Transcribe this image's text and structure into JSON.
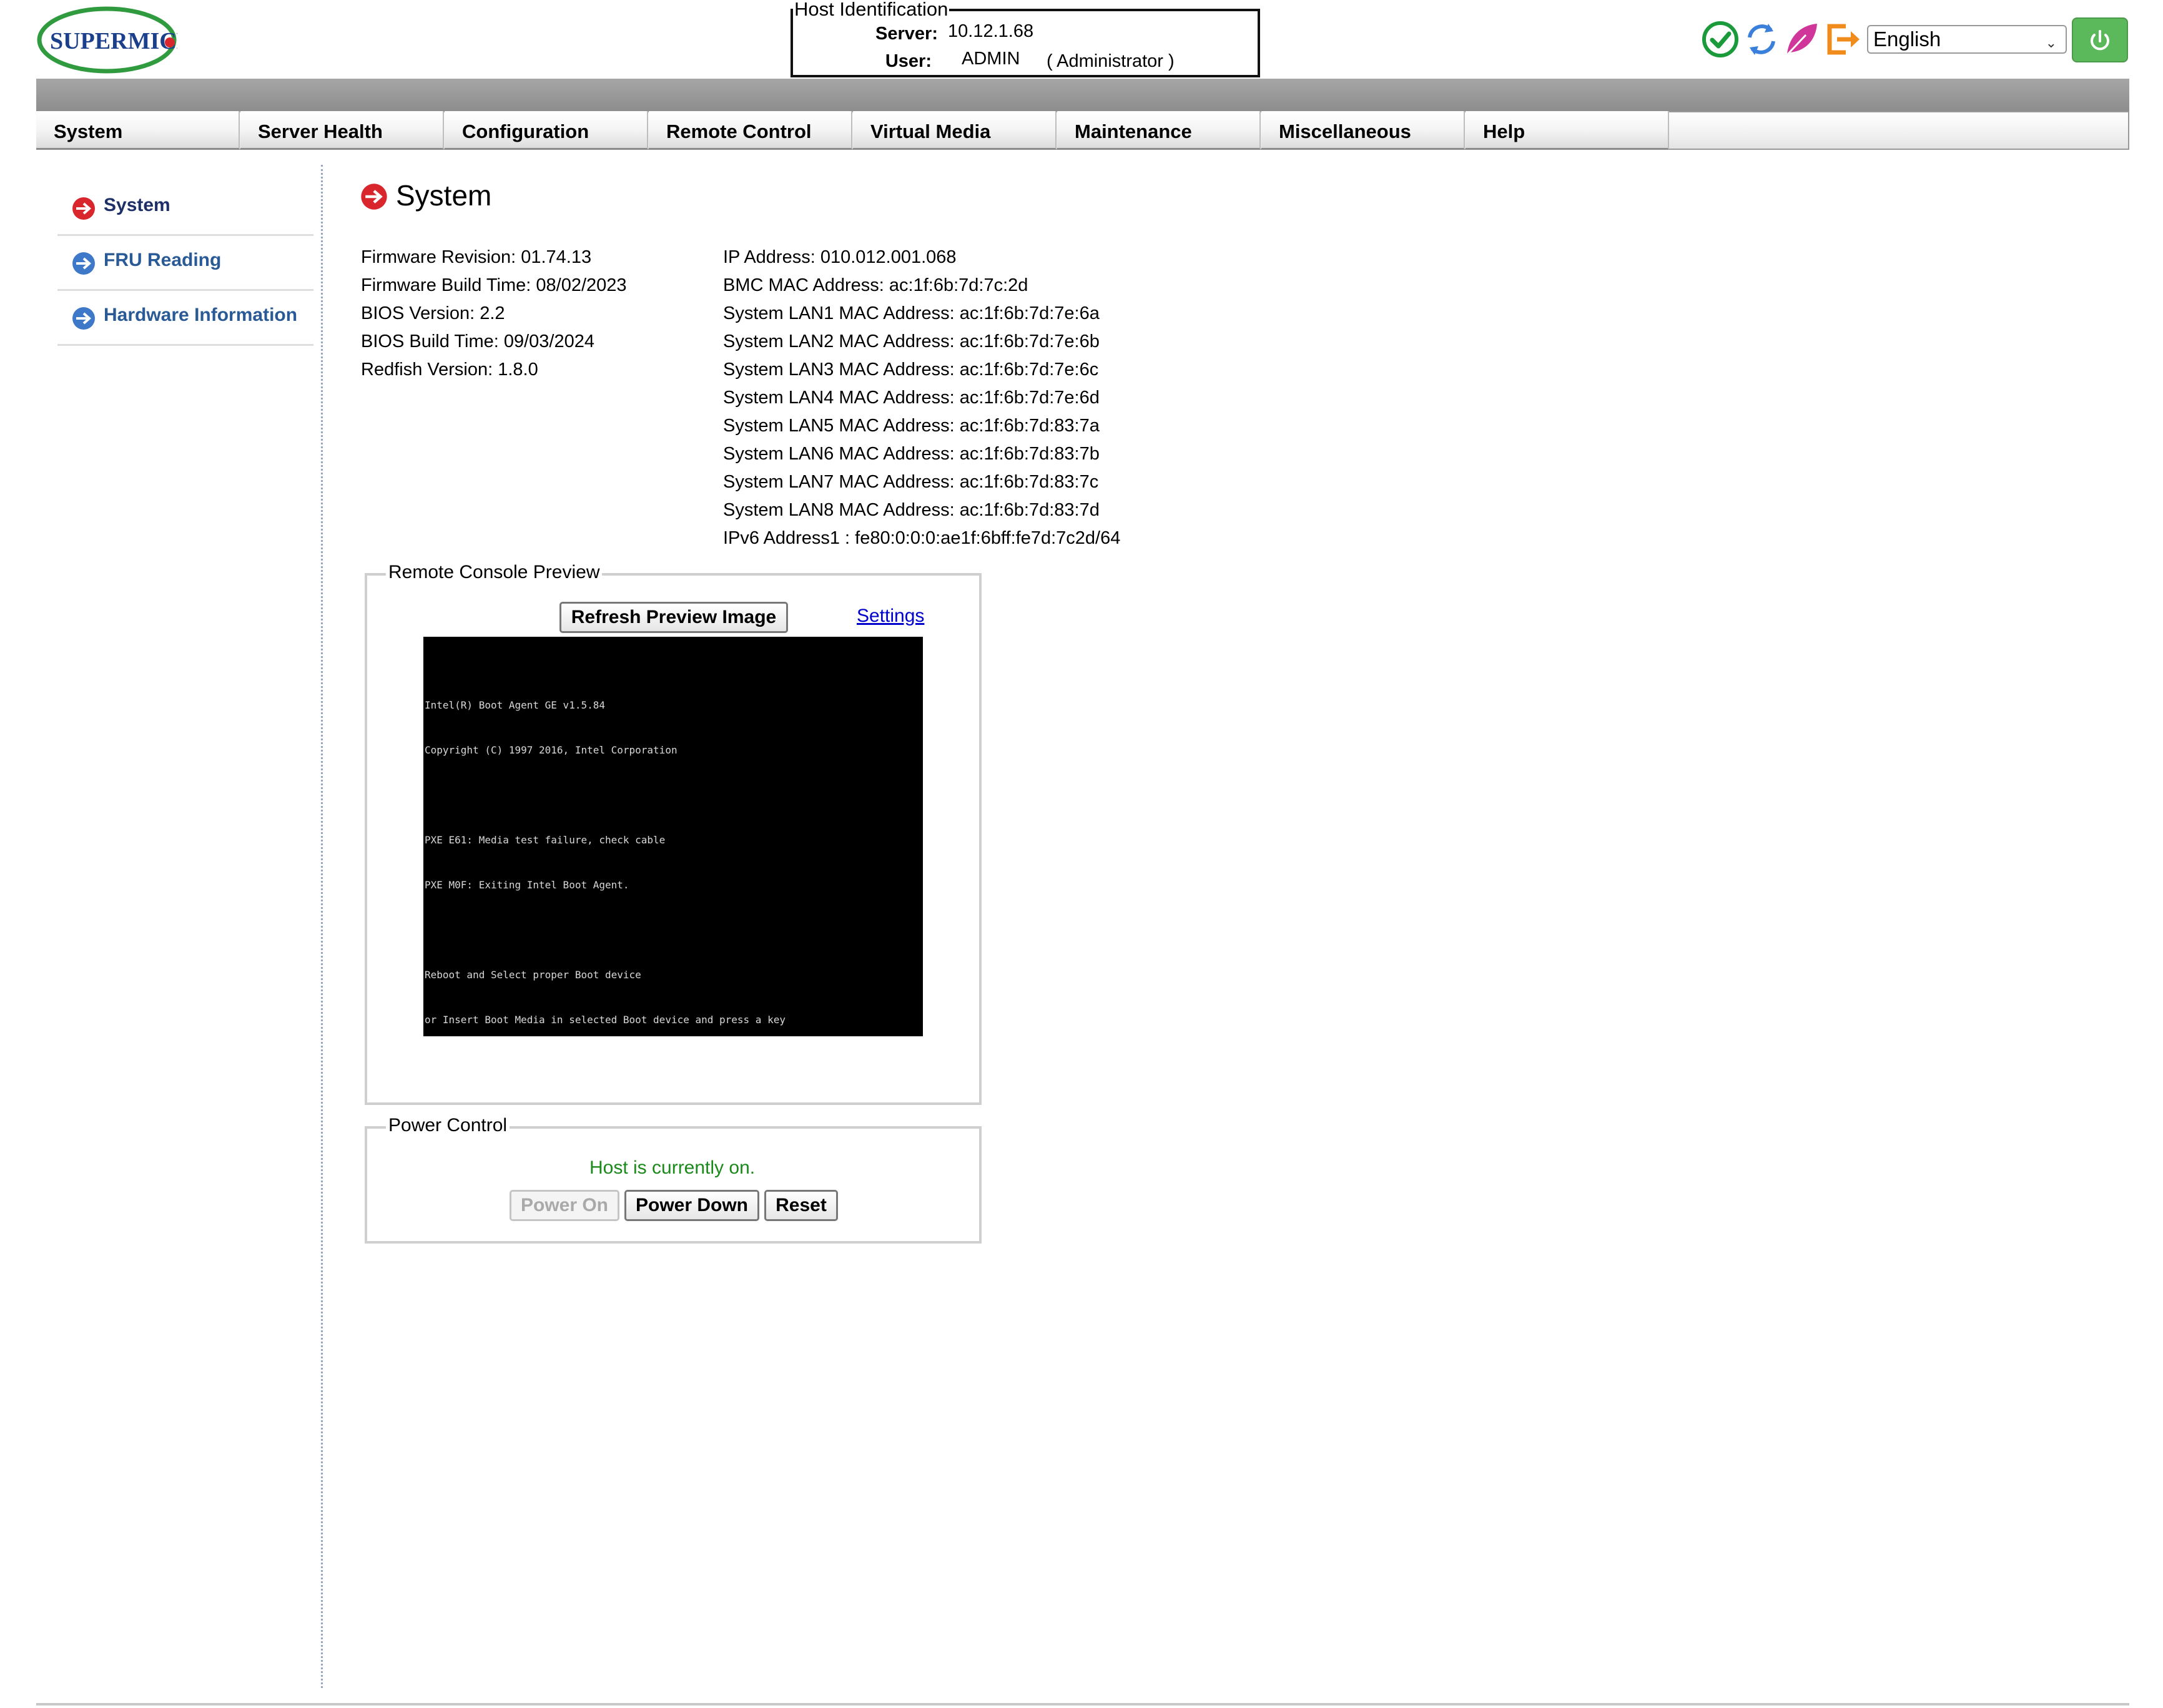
{
  "brand": {
    "logo_text": "SUPERMICRO"
  },
  "host_identification": {
    "legend": "Host Identification",
    "server_label": "Server:",
    "server_value": "10.12.1.68",
    "user_label": "User:",
    "user_value": "ADMIN",
    "user_role": "( Administrator )"
  },
  "toolbar": {
    "icons": [
      "check-circle-icon",
      "refresh-icon",
      "leaf-icon",
      "logout-icon",
      "power-icon"
    ],
    "language_selected": "English",
    "colors": {
      "check": "#1a9a3a",
      "refresh": "#3a7fd9",
      "leaf": "#d0359a",
      "logout": "#f08c1c",
      "power": "#5bb85b"
    }
  },
  "nav": {
    "tabs": [
      "System",
      "Server Health",
      "Configuration",
      "Remote Control",
      "Virtual Media",
      "Maintenance",
      "Miscellaneous",
      "Help"
    ]
  },
  "sidebar": {
    "items": [
      {
        "label": "System",
        "active": true
      },
      {
        "label": "FRU Reading",
        "active": false
      },
      {
        "label": "Hardware Information",
        "active": false
      }
    ]
  },
  "page": {
    "title": "System"
  },
  "left_info": [
    "Firmware Revision:  01.74.13",
    "Firmware Build Time:  08/02/2023",
    "BIOS Version: 2.2",
    "BIOS Build Time: 09/03/2024",
    "Redfish Version: 1.8.0"
  ],
  "right_info": [
    "IP Address:  010.012.001.068",
    "BMC MAC Address:  ac:1f:6b:7d:7c:2d",
    "System LAN1 MAC Address: ac:1f:6b:7d:7e:6a",
    "System LAN2 MAC Address: ac:1f:6b:7d:7e:6b",
    "System LAN3 MAC Address: ac:1f:6b:7d:7e:6c",
    "System LAN4 MAC Address: ac:1f:6b:7d:7e:6d",
    "System LAN5 MAC Address: ac:1f:6b:7d:83:7a",
    "System LAN6 MAC Address: ac:1f:6b:7d:83:7b",
    "System LAN7 MAC Address: ac:1f:6b:7d:83:7c",
    "System LAN8 MAC Address: ac:1f:6b:7d:83:7d",
    "IPv6 Address1 : fe80:0:0:0:ae1f:6bff:fe7d:7c2d/64"
  ],
  "remote_console": {
    "legend": "Remote Console Preview",
    "refresh_button": "Refresh Preview Image",
    "settings_link": "Settings",
    "screen_lines": [
      "Intel(R) Boot Agent GE v1.5.84",
      "Copyright (C) 1997 2016, Intel Corporation",
      "",
      "PXE E61: Media test failure, check cable",
      "PXE M0F: Exiting Intel Boot Agent.",
      "",
      "Reboot and Select proper Boot device",
      "or Insert Boot Media in selected Boot device and press a key"
    ]
  },
  "power_control": {
    "legend": "Power Control",
    "status": "Host is currently on.",
    "power_on": "Power On",
    "power_down": "Power Down",
    "reset": "Reset"
  }
}
